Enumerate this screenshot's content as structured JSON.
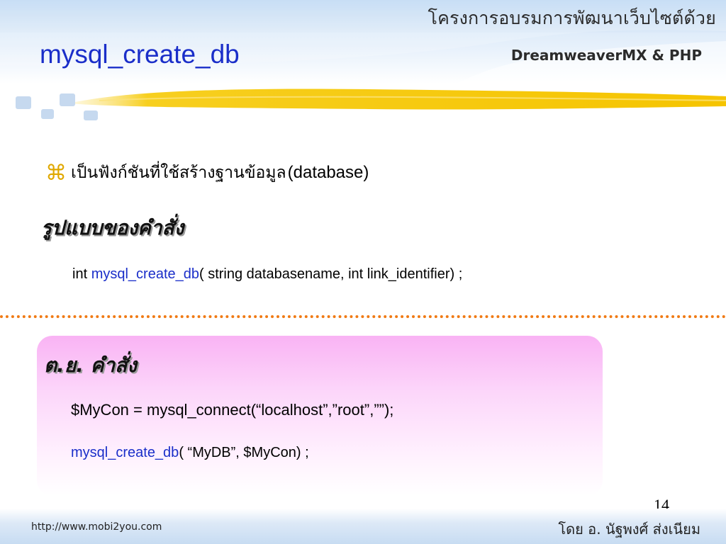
{
  "header": {
    "brand_thai": "โครงการอบรมการพัฒนาเว็บไซต์ด้วย",
    "brand_sub": "DreamweaverMX & PHP"
  },
  "slide": {
    "title": "mysql_create_db",
    "bullet": {
      "glyph": "⌘",
      "thai_text": "เป็นฟังก์ชันที่ใช้สร้างฐานข้อมูล",
      "paren_text": "(database)"
    },
    "syntax_heading": "รูปแบบของคำสั่ง",
    "syntax": {
      "return_type": "int",
      "function_name": "mysql_create_db",
      "params": "( string databasename, int link_identifier) ;"
    },
    "example": {
      "heading": "ต.ย. คำสั่ง",
      "line1": "$MyCon = mysql_connect(“localhost”,”root”,””);",
      "line2_fn": "mysql_create_db",
      "line2_args": "( “MyDB”, $MyCon) ;"
    },
    "page_number": "14"
  },
  "footer": {
    "url": "http://www.mobi2you.com",
    "author": "โดย อ. นัฐพงศ์  ส่งเนียม"
  },
  "colors": {
    "title_blue": "#1a2ec9",
    "accent_yellow": "#f5c400",
    "separator_orange": "#f07a14",
    "example_pink": "#f9b3f4"
  }
}
